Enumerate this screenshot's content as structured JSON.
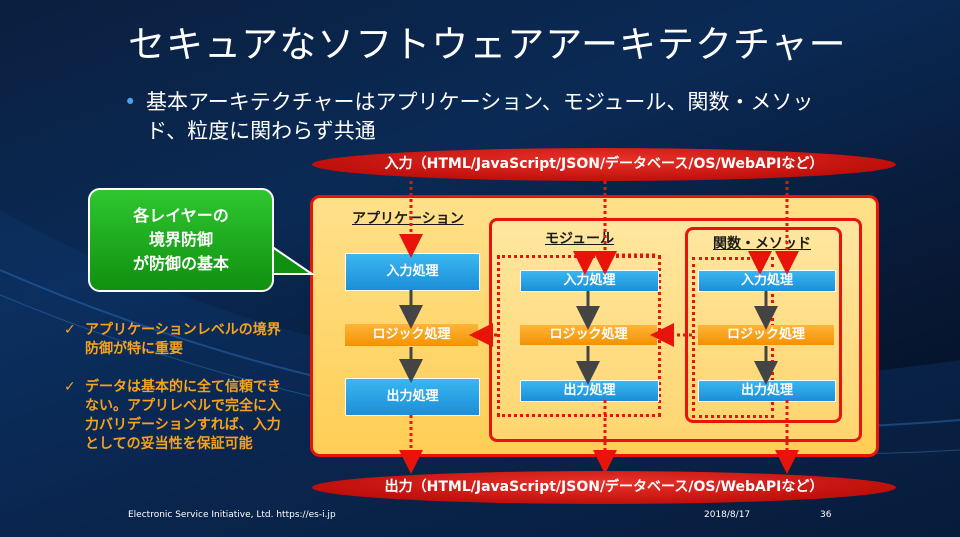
{
  "slide": {
    "title": "セキュアなソフトウェアアーキテクチャー",
    "bullet": "基本アーキテクチャーはアプリケーション、モジュール、関数・メソッド、粒度に関わらず共通"
  },
  "input_band": "入力（HTML/JavaScript/JSON/データベース/OS/WebAPIなど）",
  "output_band": "出力（HTML/JavaScript/JSON/データベース/OS/WebAPIなど）",
  "layers": {
    "application": {
      "label": "アプリケーション",
      "input": "入力処理",
      "logic": "ロジック処理",
      "output": "出力処理"
    },
    "module": {
      "label": "モジュール",
      "input": "入力処理",
      "logic": "ロジック処理",
      "output": "出力処理"
    },
    "function": {
      "label": "関数・メソッド",
      "input": "入力処理",
      "logic": "ロジック処理",
      "output": "出力処理"
    }
  },
  "callout": {
    "line1": "各レイヤーの",
    "line2": "境界防御",
    "line3": "が防御の基本"
  },
  "checks": [
    "アプリケーションレベルの境界防御が特に重要",
    "データは基本的に全て信頼できない。アプリレベルで完全に入力バリデーションすれば、入力としての妥当性を保証可能"
  ],
  "footer": {
    "org": "Electronic Service Initiative, Ltd. https://es-i.jp",
    "date": "2018/8/17",
    "page": "36"
  },
  "colors": {
    "accent_red": "#e8140c",
    "process_blue": "#1c8ed8",
    "logic_orange": "#f39200",
    "callout_green": "#109010",
    "check_orange": "#f7a21b"
  }
}
